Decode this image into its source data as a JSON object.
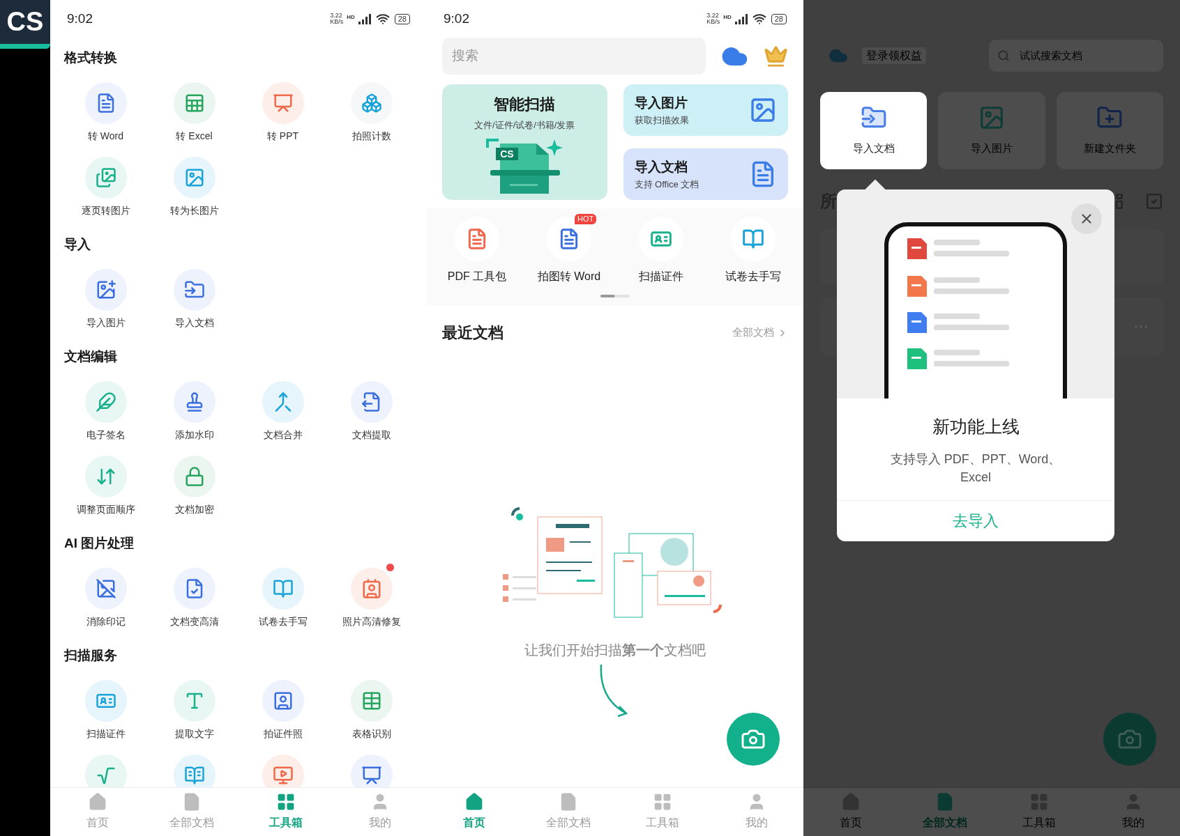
{
  "logo": {
    "text": "CS"
  },
  "toolbox_screen": {
    "status_bar": {
      "time": "9:02",
      "speed": "3.22",
      "speed_unit": "KB/s",
      "network": "HD",
      "battery": "28"
    },
    "sections": [
      {
        "title": "格式转换",
        "items": [
          {
            "label": "转 Word",
            "dot": false
          },
          {
            "label": "转 Excel",
            "dot": false
          },
          {
            "label": "转 PPT",
            "dot": false
          },
          {
            "label": "拍照计数",
            "dot": false
          },
          {
            "label": "逐页转图片",
            "dot": false
          },
          {
            "label": "转为长图片",
            "dot": false
          }
        ]
      },
      {
        "title": "导入",
        "items": [
          {
            "label": "导入图片",
            "dot": false
          },
          {
            "label": "导入文档",
            "dot": false
          }
        ]
      },
      {
        "title": "文档编辑",
        "items": [
          {
            "label": "电子签名",
            "dot": false
          },
          {
            "label": "添加水印",
            "dot": false
          },
          {
            "label": "文档合并",
            "dot": false
          },
          {
            "label": "文档提取",
            "dot": false
          },
          {
            "label": "调整页面顺序",
            "dot": false
          },
          {
            "label": "文档加密",
            "dot": false
          }
        ]
      },
      {
        "title": "AI 图片处理",
        "items": [
          {
            "label": "消除印记",
            "dot": false
          },
          {
            "label": "文档变高清",
            "dot": false
          },
          {
            "label": "试卷去手写",
            "dot": false
          },
          {
            "label": "照片高清修复",
            "dot": true
          }
        ]
      },
      {
        "title": "扫描服务",
        "items": [
          {
            "label": "扫描证件",
            "dot": false
          },
          {
            "label": "提取文字",
            "dot": false
          },
          {
            "label": "拍证件照",
            "dot": false
          },
          {
            "label": "表格识别",
            "dot": false
          },
          {
            "dot": false
          },
          {
            "dot": false
          },
          {
            "dot": false
          },
          {
            "dot": false
          }
        ]
      }
    ],
    "bottom_nav": [
      {
        "label": "首页",
        "selected": false
      },
      {
        "label": "全部文档",
        "selected": false
      },
      {
        "label": "工具箱",
        "selected": true
      },
      {
        "label": "我的",
        "selected": false
      }
    ]
  },
  "home_screen": {
    "status_bar": {
      "time": "9:02",
      "speed": "3.22",
      "speed_unit": "KB/s",
      "network": "HD",
      "battery": "28"
    },
    "search": {
      "placeholder": "搜索"
    },
    "smart_scan": {
      "title": "智能扫描",
      "subtitle": "文件/证件/试卷/书籍/发票",
      "badge": "CS"
    },
    "import_cards": [
      {
        "title": "导入图片",
        "subtitle": "获取扫描效果"
      },
      {
        "title": "导入文档",
        "subtitle": "支持 Office 文档"
      }
    ],
    "quick_tools": [
      {
        "label": "PDF 工具包"
      },
      {
        "label": "拍图转 Word",
        "badge": "HOT"
      },
      {
        "label": "扫描证件"
      },
      {
        "label": "试卷去手写"
      }
    ],
    "recent": {
      "title": "最近文档",
      "link": "全部文档"
    },
    "empty_state": {
      "message": "让我们开始扫描**第一个**文档吧"
    },
    "bottom_nav": [
      {
        "label": "首页",
        "selected": true
      },
      {
        "label": "全部文档",
        "selected": false
      },
      {
        "label": "工具箱",
        "selected": false
      },
      {
        "label": "我的",
        "selected": false
      }
    ]
  },
  "import_screen": {
    "login": {
      "label": "登录领权益"
    },
    "search": {
      "placeholder": "试试搜索文档"
    },
    "tiles": [
      {
        "label": "导入文档",
        "highlighted": true
      },
      {
        "label": "导入图片",
        "highlighted": false
      },
      {
        "label": "新建文件夹",
        "highlighted": false
      }
    ],
    "section_heading": "所",
    "popup": {
      "title": "新功能上线",
      "description": "支持导入 PDF、PPT、Word、Excel",
      "action": "去导入"
    },
    "bottom_nav": [
      {
        "label": "首页",
        "selected": false
      },
      {
        "label": "全部文档",
        "selected": true
      },
      {
        "label": "工具箱",
        "selected": false
      },
      {
        "label": "我的",
        "selected": false
      }
    ]
  }
}
